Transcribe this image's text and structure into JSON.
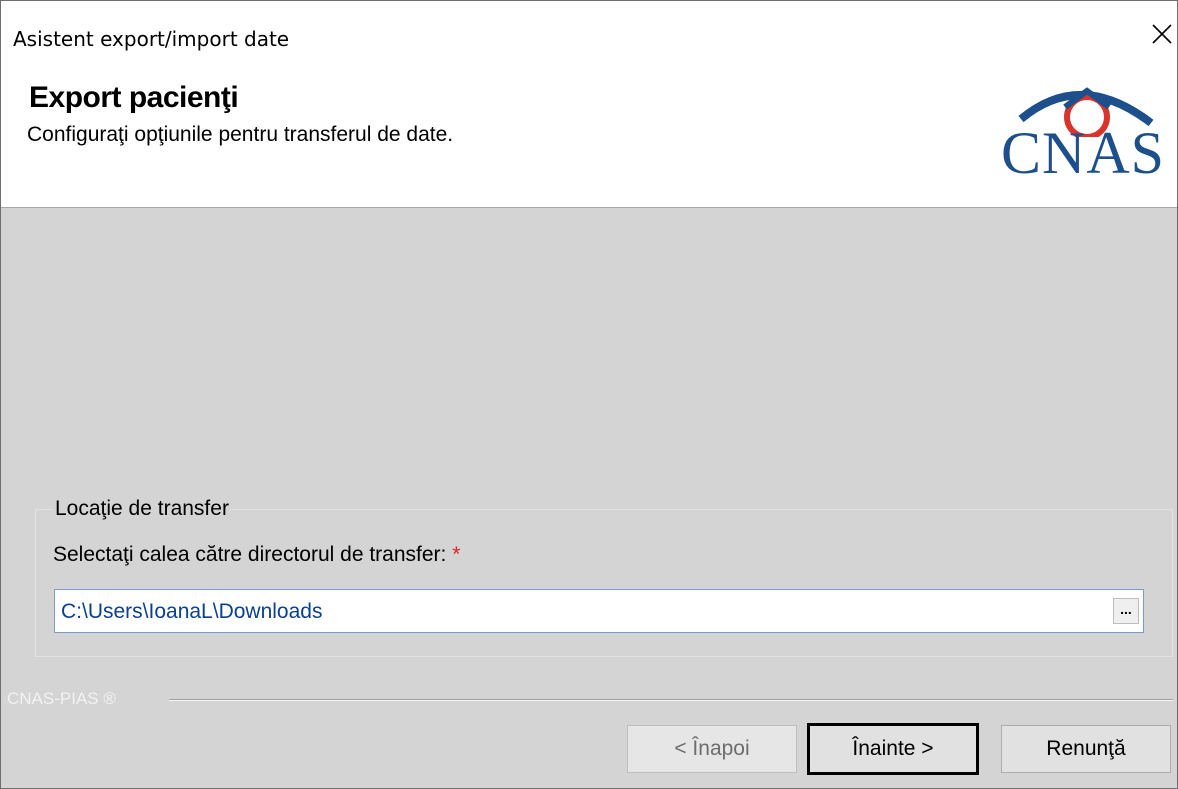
{
  "window": {
    "title": "Asistent export/import date"
  },
  "header": {
    "title": "Export pacienţi",
    "subtitle": "Configuraţi opţiunile pentru transferul de date.",
    "logo_text": "CNAS",
    "logo_colors": {
      "text": "#1d4f8c",
      "arc": "#d9342b"
    }
  },
  "transfer": {
    "group_title": "Locaţie de transfer",
    "path_label": "Selectaţi calea către directorul de transfer:",
    "required_mark": "*",
    "path_value": "C:\\Users\\IoanaL\\Downloads",
    "browse_label": "..."
  },
  "footer": {
    "brand": "CNAS-PIAS ®"
  },
  "buttons": {
    "back": "< Înapoi",
    "next": "Înainte >",
    "cancel": "Renunţă"
  }
}
